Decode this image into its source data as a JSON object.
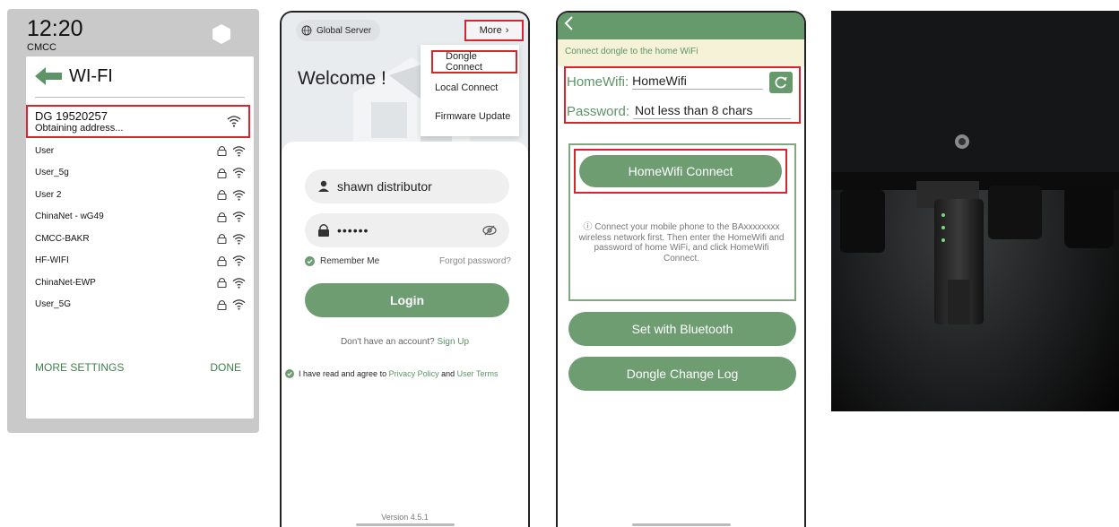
{
  "wifi": {
    "time": "12:20",
    "carrier": "CMCC",
    "title": "WI-FI",
    "selected": {
      "name": "DG 19520257",
      "status": "Obtaining address..."
    },
    "networks": [
      "User",
      "User_5g",
      "User 2",
      "ChinaNet - wG49",
      "CMCC-BAKR",
      "HF-WIFI",
      "ChinaNet-EWP",
      "User_5G"
    ],
    "more_settings": "MORE SETTINGS",
    "done": "DONE"
  },
  "login": {
    "server": "Global Server",
    "more": "More",
    "menu": [
      "Dongle Connect",
      "Local Connect",
      "Firmware Update"
    ],
    "welcome": "Welcome !",
    "username": "shawn distributor",
    "password_mask": "••••••",
    "remember": "Remember Me",
    "forgot": "Forgot password?",
    "login_btn": "Login",
    "no_account": "Don't have an account?",
    "signup": "Sign Up",
    "agree_prefix": "I have read and agree to",
    "privacy": "Privacy Policy",
    "and": "and",
    "terms": "User Terms",
    "version": "Version 4.5.1"
  },
  "dongle": {
    "notice": "Connect dongle to the home WiFi",
    "wifi_label": "HomeWifi:",
    "wifi_value": "HomeWifi",
    "pw_label": "Password:",
    "pw_placeholder": "Not less than 8 chars",
    "connect_btn": "HomeWifi Connect",
    "info": "Connect your mobile phone to the BAxxxxxxxx wireless network first. Then enter the HomeWifi and password of home WiFi, and click HomeWifi Connect.",
    "bluetooth_btn": "Set with Bluetooth",
    "log_btn": "Dongle Change Log"
  },
  "colors": {
    "accent_green": "#6e9d72",
    "highlight_red": "#d9232d"
  }
}
